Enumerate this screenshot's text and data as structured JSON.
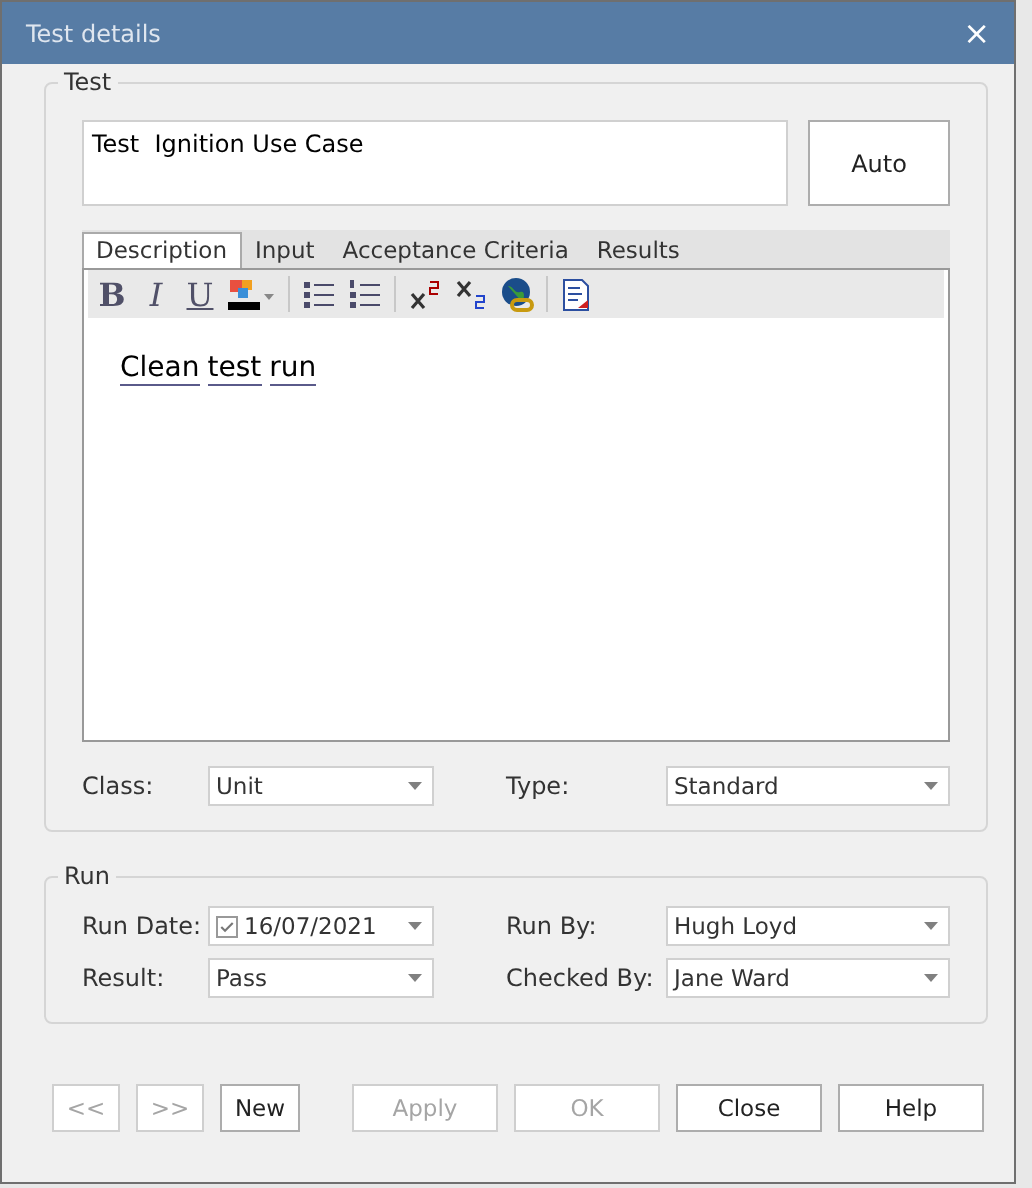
{
  "window": {
    "title": "Test details",
    "close": "×"
  },
  "test_group": {
    "legend": "Test",
    "name": "Test  Ignition Use Case",
    "auto_button": "Auto",
    "tabs": [
      {
        "label": "Description",
        "selected": true
      },
      {
        "label": "Input",
        "selected": false
      },
      {
        "label": "Acceptance Criteria",
        "selected": false
      },
      {
        "label": "Results",
        "selected": false
      }
    ],
    "toolbar": [
      {
        "kind": "bold",
        "label": "B"
      },
      {
        "kind": "italic",
        "label": "I"
      },
      {
        "kind": "underline",
        "label": "U"
      },
      {
        "kind": "color"
      },
      {
        "kind": "sep"
      },
      {
        "kind": "bullets"
      },
      {
        "kind": "numbers"
      },
      {
        "kind": "sep"
      },
      {
        "kind": "superscript"
      },
      {
        "kind": "subscript"
      },
      {
        "kind": "hyperlink"
      },
      {
        "kind": "sep"
      },
      {
        "kind": "document"
      }
    ],
    "description": [
      "Clean",
      "test",
      "run"
    ],
    "fields": [
      {
        "label": "Class:",
        "value": "Unit"
      },
      {
        "label": "Type:",
        "value": "Standard"
      }
    ]
  },
  "run_group": {
    "legend": "Run",
    "fields": [
      {
        "label": "Run Date:",
        "value": "16/07/2021",
        "checked": true
      },
      {
        "label": "Run By:",
        "value": "Hugh Loyd"
      },
      {
        "label": "Result:",
        "value": "Pass"
      },
      {
        "label": "Checked By:",
        "value": "Jane Ward"
      }
    ]
  },
  "buttons": [
    {
      "label": "<<",
      "disabled": true
    },
    {
      "label": ">>",
      "disabled": true
    },
    {
      "label": "New",
      "disabled": false
    },
    {
      "label": "Apply",
      "disabled": true
    },
    {
      "label": "OK",
      "disabled": true
    },
    {
      "label": "Close",
      "disabled": false
    },
    {
      "label": "Help",
      "disabled": false
    }
  ]
}
